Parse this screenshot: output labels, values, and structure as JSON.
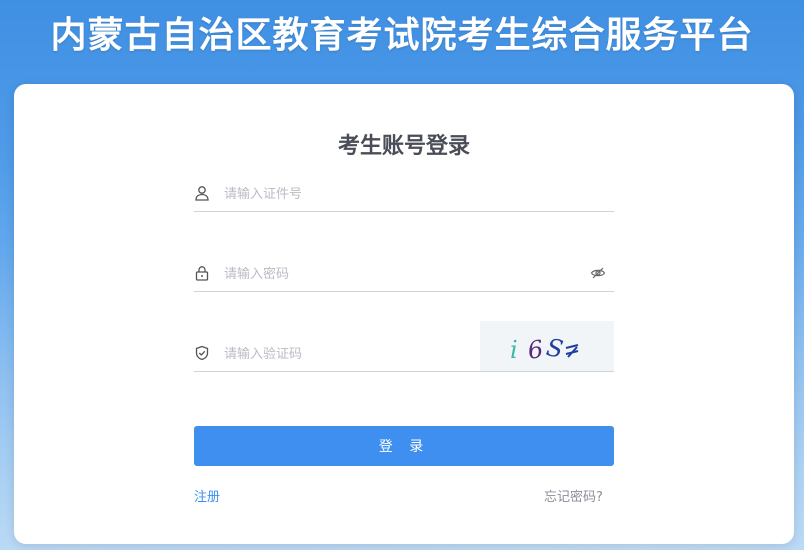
{
  "header": {
    "title": "内蒙古自治区教育考试院考生综合服务平台"
  },
  "login": {
    "title": "考生账号登录",
    "id_placeholder": "请输入证件号",
    "password_placeholder": "请输入密码",
    "captcha_placeholder": "请输入验证码",
    "captcha_text": "i6S≥",
    "submit_label": "登 录",
    "register_label": "注册",
    "forgot_label": "忘记密码?"
  },
  "colors": {
    "accent": "#3e8ff0",
    "background_top": "#3f8fe3",
    "title_text": "#4a4d57"
  },
  "icons": {
    "id": "user-icon",
    "password": "lock-icon",
    "password_toggle": "eye-off-icon",
    "captcha": "shield-check-icon"
  }
}
